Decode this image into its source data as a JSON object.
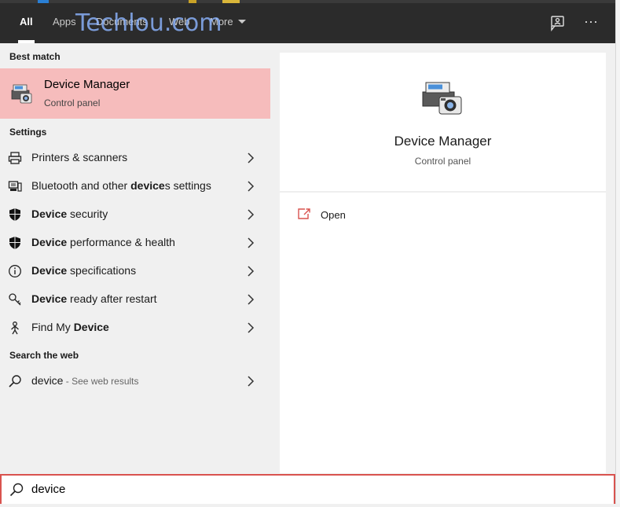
{
  "header": {
    "tabs": [
      {
        "label": "All",
        "active": true
      },
      {
        "label": "Apps",
        "active": false
      },
      {
        "label": "Documents",
        "active": false
      },
      {
        "label": "Web",
        "active": false
      },
      {
        "label": "More",
        "active": false
      }
    ],
    "watermark": "Techlou.com",
    "more_options_glyph": "···"
  },
  "best_match": {
    "section_label": "Best match",
    "title": "Device Manager",
    "subtitle": "Control panel",
    "icon": "device-manager-icon"
  },
  "settings": {
    "section_label": "Settings",
    "items": [
      {
        "pre": "Printers & scanners",
        "bold": "",
        "post": "",
        "icon": "printer-icon"
      },
      {
        "pre": "Bluetooth and other ",
        "bold": "device",
        "post": "s settings",
        "icon": "bluetooth-devices-icon"
      },
      {
        "pre": "",
        "bold": "Device",
        "post": " security",
        "icon": "shield-icon"
      },
      {
        "pre": "",
        "bold": "Device",
        "post": " performance & health",
        "icon": "shield-health-icon"
      },
      {
        "pre": "",
        "bold": "Device",
        "post": " specifications",
        "icon": "info-icon"
      },
      {
        "pre": "",
        "bold": "Device",
        "post": " ready after restart",
        "icon": "key-restart-icon"
      },
      {
        "pre": "Find My ",
        "bold": "Device",
        "post": "",
        "icon": "person-location-icon"
      }
    ]
  },
  "web": {
    "section_label": "Search the web",
    "query": "device",
    "suffix": " - See web results",
    "icon": "search-icon"
  },
  "detail": {
    "title": "Device Manager",
    "subtitle": "Control panel",
    "actions": [
      {
        "label": "Open",
        "icon": "open-icon"
      }
    ]
  },
  "search": {
    "value": "device",
    "icon": "search-icon"
  },
  "colors": {
    "accent": "#d9534f",
    "highlight": "#f6bcbc",
    "header_bg": "#2b2b2b",
    "pane_bg": "#f0f0f0"
  }
}
